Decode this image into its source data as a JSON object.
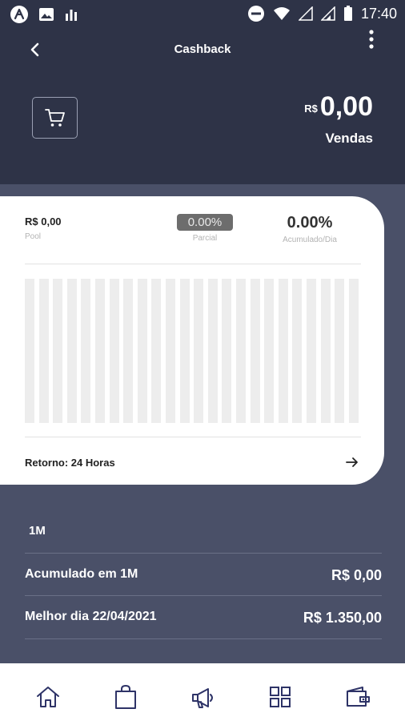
{
  "status_bar": {
    "time": "17:40"
  },
  "header": {
    "title": "Cashback",
    "sales_currency": "R$",
    "sales_amount": "0,00",
    "sales_label": "Vendas"
  },
  "card": {
    "pool_value": "R$ 0,00",
    "pool_label": "Pool",
    "parcial_value": "0.00%",
    "parcial_label": "Parcial",
    "acumulado_value": "0.00%",
    "acumulado_label": "Acumulado/Dia",
    "return_label": "Retorno: 24 Horas"
  },
  "summary": {
    "period": "1M",
    "rows": [
      {
        "label": "Acumulado em 1M",
        "value": "R$ 0,00"
      },
      {
        "label": "Melhor dia 22/04/2021",
        "value": "R$ 1.350,00"
      }
    ]
  },
  "bottom_nav": {
    "icons": [
      "home-icon",
      "shopping-bag-icon",
      "megaphone-icon",
      "grid-icon",
      "wallet-icon"
    ],
    "active_color": "#2e3367"
  },
  "colors": {
    "header_bg": "#2e3347",
    "body_bg": "#4a5068",
    "card_bg": "#ffffff",
    "pill_bg": "#6d6d6d"
  }
}
